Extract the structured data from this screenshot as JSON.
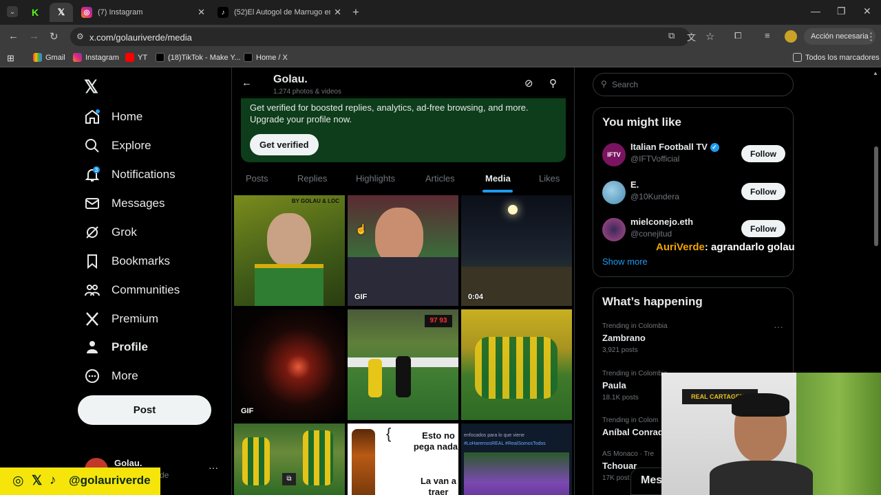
{
  "browser": {
    "tabs": [
      {
        "label": "",
        "icon": "kick-icon"
      },
      {
        "label": "",
        "icon": "x-icon"
      },
      {
        "label": "(7) Instagram",
        "icon": "instagram-icon"
      },
      {
        "label": "(52)El Autogol de Marrugo en C",
        "icon": "tiktok-icon"
      }
    ],
    "url": "x.com/golauriverde/media",
    "action_label": "Acción necesaria",
    "bookmarks": [
      "Gmail",
      "Instagram",
      "YT",
      "(18)TikTok - Make Y...",
      "Home / X"
    ],
    "all_bookmarks": "Todos los marcadores"
  },
  "sidebar": {
    "items": [
      {
        "label": "Home",
        "icon": "home-icon"
      },
      {
        "label": "Explore",
        "icon": "search-icon"
      },
      {
        "label": "Notifications",
        "icon": "bell-icon",
        "badge": "3"
      },
      {
        "label": "Messages",
        "icon": "mail-icon"
      },
      {
        "label": "Grok",
        "icon": "grok-icon"
      },
      {
        "label": "Bookmarks",
        "icon": "bookmark-icon"
      },
      {
        "label": "Communities",
        "icon": "people-icon"
      },
      {
        "label": "Premium",
        "icon": "x-icon"
      },
      {
        "label": "Profile",
        "icon": "person-icon"
      },
      {
        "label": "More",
        "icon": "more-circle-icon"
      }
    ],
    "post_label": "Post",
    "user_name": "Golau.",
    "user_handle_partial": "rde"
  },
  "profile": {
    "name": "Golau.",
    "count": "1,274 photos & videos",
    "verify_text": "Get verified for boosted replies, analytics, ad-free browsing, and more. Upgrade your profile now.",
    "get_verified": "Get verified",
    "tabs": [
      "Posts",
      "Replies",
      "Highlights",
      "Articles",
      "Media",
      "Likes"
    ],
    "active_tab": "Media"
  },
  "media": [
    {
      "badge": ""
    },
    {
      "badge": "GIF"
    },
    {
      "badge": "0:04"
    },
    {
      "badge": "GIF"
    },
    {
      "badge": ""
    },
    {
      "badge": ""
    },
    {
      "badge": ""
    },
    {
      "badge": ""
    },
    {
      "badge": ""
    }
  ],
  "media_text": {
    "cell8_line1": "Esto no",
    "cell8_line2": "pega nada",
    "cell8_line3": "La van a",
    "cell8_line4": "traer",
    "cell5_score": "97 93",
    "cell1_caption": "BY GOLAU & LOC",
    "cell9_caption1": "#LoHaremosREAL #RealSomosTodos",
    "cell9_caption2": "enfocados para lo que viene"
  },
  "right": {
    "search_placeholder": "Search",
    "you_might_like": "You might like",
    "suggestions": [
      {
        "name": "Italian Football TV",
        "handle": "@IFTVofficial",
        "avatar_text": "IFTV",
        "verified": true
      },
      {
        "name": "E.",
        "handle": "@10Kundera",
        "avatar_text": ""
      },
      {
        "name": "mielconejo.eth",
        "handle": "@conejitud",
        "avatar_text": ""
      }
    ],
    "follow_label": "Follow",
    "show_more": "Show more",
    "whats_happening": "What’s happening",
    "trends": [
      {
        "meta": "Trending in Colombia",
        "name": "Zambrano",
        "posts": "3,921 posts"
      },
      {
        "meta": "Trending in Colombia",
        "name": "Paula",
        "posts": "18.1K posts"
      },
      {
        "meta": "Trending in Colom",
        "name": "Aníbal Conrad",
        "posts": ""
      },
      {
        "meta": "AS Monaco · Tre",
        "name": "Tchouar",
        "posts": "17K post"
      }
    ],
    "messages_partial": "Mes"
  },
  "overlay": {
    "chat_user": "AuriVerde",
    "chat_msg": ": agrandarlo golau",
    "handle": "@golauriverde",
    "webcam_banner": "REAL CARTAGENA"
  },
  "colors": {
    "accent": "#1d9bf0",
    "banner_green": "#0d3d1a",
    "overlay_yellow": "#f5e50a",
    "chat_orange": "#f0a500"
  }
}
